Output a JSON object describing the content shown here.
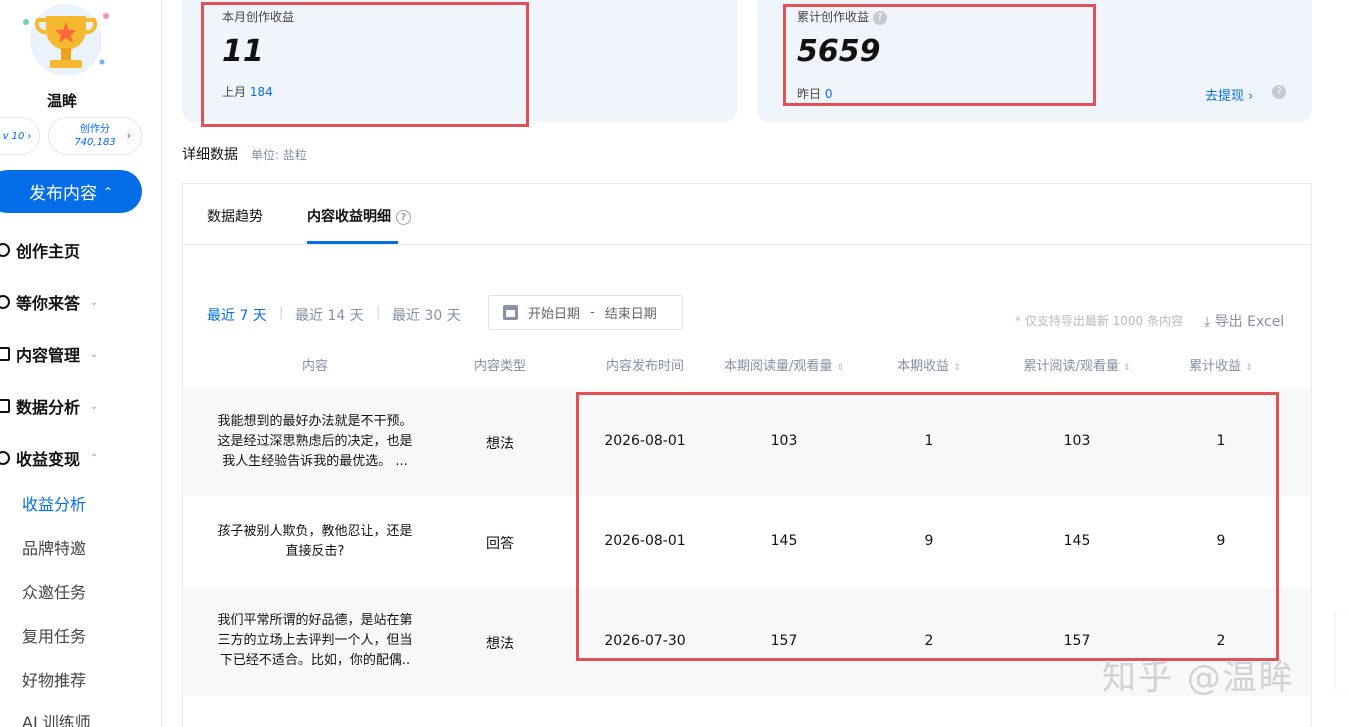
{
  "sidebar": {
    "username": "温眸",
    "level_pill": "v 10",
    "score_label": "创作分",
    "score_value": "740,183",
    "publish_label": "发布内容",
    "nav": [
      {
        "label": "创作主页",
        "icon": "user-icon"
      },
      {
        "label": "等你来答",
        "icon": "pen-icon"
      },
      {
        "label": "内容管理",
        "icon": "document-icon"
      },
      {
        "label": "数据分析",
        "icon": "chart-icon"
      },
      {
        "label": "收益变现",
        "icon": "money-icon"
      }
    ],
    "sub_items": [
      "收益分析",
      "品牌特邀",
      "众邀任务",
      "复用任务",
      "好物推荐",
      "AI 训练师"
    ]
  },
  "stats": {
    "month": {
      "label": "本月创作收益",
      "value": "11",
      "sub_label": "上月",
      "sub_value": "184"
    },
    "total": {
      "label": "累计创作收益",
      "value": "5659",
      "sub_label": "昨日",
      "sub_value": "0",
      "withdraw": "去提现"
    }
  },
  "detail": {
    "title": "详细数据",
    "unit": "单位: 盐粒"
  },
  "tabs": [
    "数据趋势",
    "内容收益明细"
  ],
  "filters": [
    "最近 7 天",
    "最近 14 天",
    "最近 30 天"
  ],
  "date_range": {
    "start": "开始日期",
    "sep": "-",
    "end": "结束日期"
  },
  "export_note": "* 仅支持导出最新 1000 条内容",
  "export_label": "导出 Excel",
  "columns": [
    "内容",
    "内容类型",
    "内容发布时间",
    "本期阅读量/观看量",
    "本期收益",
    "累计阅读/观看量",
    "累计收益"
  ],
  "rows": [
    {
      "content": [
        "我能想到的最好办法就是不干预。",
        "这是经过深思熟虑后的决定，也是",
        "我人生经验告诉我的最优选。 ..."
      ],
      "type": "想法",
      "date": "2026-08-01",
      "reads": "103",
      "income": "1",
      "total_reads": "103",
      "total_income": "1"
    },
    {
      "content": [
        "孩子被别人欺负，教他忍让，还是",
        "直接反击?"
      ],
      "type": "回答",
      "date": "2026-08-01",
      "reads": "145",
      "income": "9",
      "total_reads": "145",
      "total_income": "9"
    },
    {
      "content": [
        "我们平常所谓的好品德，是站在第",
        "三方的立场上去评判一个人，但当",
        "下已经不适合。比如，你的配偶.."
      ],
      "type": "想法",
      "date": "2026-07-30",
      "reads": "157",
      "income": "2",
      "total_reads": "157",
      "total_income": "2"
    }
  ],
  "watermark": "知乎 @温眸",
  "colors": {
    "accent": "#056de8",
    "highlight_box": "#e05258",
    "card_bg": "#f0f5fc"
  }
}
